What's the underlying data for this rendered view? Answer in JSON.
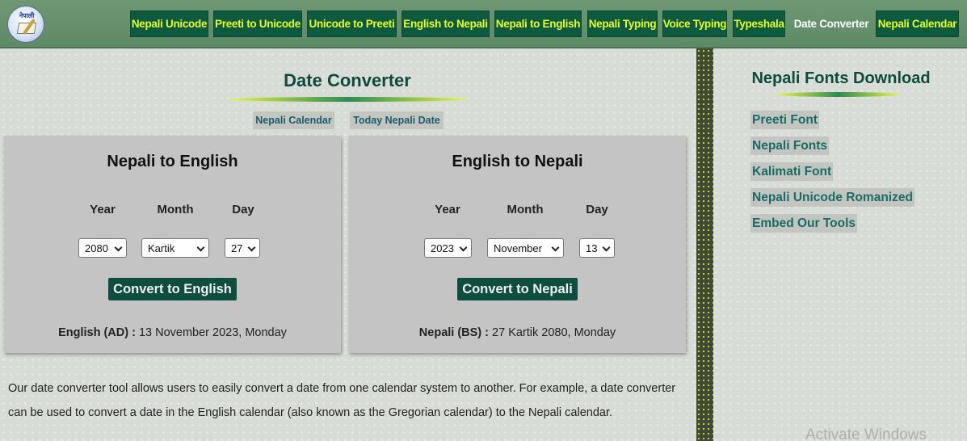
{
  "header": {
    "logo_text": "नेपाली",
    "nav": [
      {
        "label": "Nepali Unicode",
        "active": false
      },
      {
        "label": "Preeti to Unicode",
        "active": false
      },
      {
        "label": "Unicode to Preeti",
        "active": false
      },
      {
        "label": "English to Nepali",
        "active": false
      },
      {
        "label": "Nepali to English",
        "active": false
      },
      {
        "label": "Nepali Typing",
        "active": false
      },
      {
        "label": "Voice Typing",
        "active": false
      },
      {
        "label": "Typeshala",
        "active": false
      },
      {
        "label": "Date Converter",
        "active": true
      },
      {
        "label": "Nepali Calendar",
        "active": false
      }
    ]
  },
  "main": {
    "title": "Date Converter",
    "links": [
      "Nepali Calendar",
      "Today Nepali Date"
    ],
    "panels": [
      {
        "title": "Nepali to English",
        "labels": {
          "year": "Year",
          "month": "Month",
          "day": "Day"
        },
        "year": "2080",
        "month": "Kartik",
        "day": "27",
        "button": "Convert to English",
        "result_label": "English (AD) :",
        "result_value": "13 November 2023, Monday"
      },
      {
        "title": "English to Nepali",
        "labels": {
          "year": "Year",
          "month": "Month",
          "day": "Day"
        },
        "year": "2023",
        "month": "November",
        "day": "13",
        "button": "Convert to Nepali",
        "result_label": "Nepali (BS) :",
        "result_value": "27 Kartik 2080, Monday"
      }
    ],
    "description": "Our date converter tool allows users to easily convert a date from one calendar system to another. For example, a date converter can be used to convert a date in the English calendar (also known as the Gregorian calendar) to the Nepali calendar."
  },
  "sidebar": {
    "title": "Nepali Fonts Download",
    "links": [
      "Preeti Font",
      "Nepali Fonts",
      "Kalimati Font",
      "Nepali Unicode Romanized",
      "Embed Our Tools"
    ]
  },
  "watermark": "Activate Windows",
  "colors": {
    "nav_bg": "#0d5a3e",
    "nav_text": "#e6ff2a",
    "header_bg": "#6e9873",
    "title_text": "#0f4a3e",
    "button_bg": "#0f4d3f",
    "panel_bg": "#c4c4c4"
  }
}
